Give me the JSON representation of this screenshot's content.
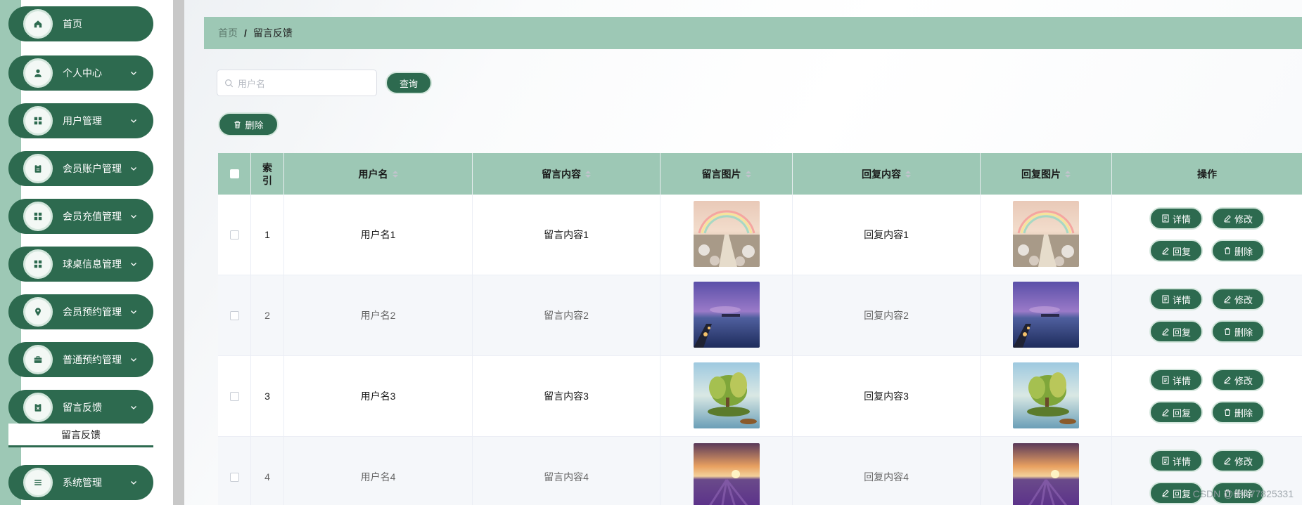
{
  "sidebar": {
    "items": [
      {
        "label": "首页",
        "icon": "home-icon",
        "has_children": false
      },
      {
        "label": "个人中心",
        "icon": "user-icon",
        "has_children": true
      },
      {
        "label": "用户管理",
        "icon": "grid-icon",
        "has_children": true
      },
      {
        "label": "会员账户管理",
        "icon": "clipboard-icon",
        "has_children": true
      },
      {
        "label": "会员充值管理",
        "icon": "grid-icon",
        "has_children": true
      },
      {
        "label": "球桌信息管理",
        "icon": "grid-icon",
        "has_children": true
      },
      {
        "label": "会员预约管理",
        "icon": "location-icon",
        "has_children": true
      },
      {
        "label": "普通预约管理",
        "icon": "briefcase-icon",
        "has_children": true
      },
      {
        "label": "留言反馈",
        "icon": "clipboard-x-icon",
        "has_children": true
      },
      {
        "label": "系统管理",
        "icon": "list-icon",
        "has_children": true
      }
    ],
    "submenu_active": "留言反馈"
  },
  "breadcrumb": {
    "home": "首页",
    "separator": "/",
    "current": "留言反馈"
  },
  "search": {
    "placeholder": "用户名",
    "query_label": "查询"
  },
  "toolbar": {
    "delete_label": "删除"
  },
  "table": {
    "headers": [
      "索引",
      "用户名",
      "留言内容",
      "留言图片",
      "回复内容",
      "回复图片",
      "操作"
    ],
    "rows": [
      {
        "index": "1",
        "username": "用户名1",
        "content": "留言内容1",
        "image": "rainbow-path",
        "reply": "回复内容1",
        "reply_image": "rainbow-path"
      },
      {
        "index": "2",
        "username": "用户名2",
        "content": "留言内容2",
        "image": "dusk-pier",
        "reply": "回复内容2",
        "reply_image": "dusk-pier"
      },
      {
        "index": "3",
        "username": "用户名3",
        "content": "留言内容3",
        "image": "tree-island",
        "reply": "回复内容3",
        "reply_image": "tree-island"
      },
      {
        "index": "4",
        "username": "用户名4",
        "content": "留言内容4",
        "image": "lavender-field",
        "reply": "回复内容4",
        "reply_image": "lavender-field"
      }
    ],
    "actions": {
      "detail": "详情",
      "edit": "修改",
      "reply": "回复",
      "delete": "删除"
    }
  },
  "watermark": "CSDN @00177825331",
  "colors": {
    "primary": "#2d6a4f",
    "header_bg": "#9dc8b5",
    "stripe": "#f5f7fa"
  }
}
